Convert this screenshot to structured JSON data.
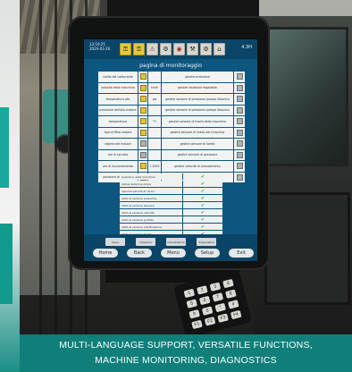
{
  "caption": {
    "line1": "MULTI-LANGUAGE SUPPORT, VERSATILE FUNCTIONS,",
    "line2": "MACHINE MONITORING, DIAGNOSTICS"
  },
  "screen": {
    "time": "13:19:25",
    "date": "2024-03-26",
    "version": "4.3H",
    "title": "pagina di monitoraggio",
    "toolbar_icons": [
      "yellow-key-icon",
      "yellow-key-icon",
      "warning-icon",
      "tool-icon",
      "alarm-icon",
      "tool-icon",
      "tool-icon",
      "home-icon"
    ],
    "rows": [
      {
        "label": "livello del carburante",
        "unit": "",
        "value": "",
        "desc": "gestire pressione",
        "icon": "box-icon"
      },
      {
        "label": "velocità della macchina",
        "unit": "",
        "value": "km/h",
        "desc": "gestire rotazione regolabile",
        "icon": "box-icon"
      },
      {
        "label": "temperatura olio",
        "unit": "",
        "value": "psi",
        "desc": "gestire sensore di pressione pompa idraulica",
        "icon": "box-icon"
      },
      {
        "label": "pressione dell'olio motore",
        "unit": "",
        "value": "",
        "desc": "gestire sensore di pressione pompa idraulica",
        "icon": "box-icon"
      },
      {
        "label": "temperatura",
        "unit": "",
        "value": "°C",
        "desc": "gestire sensore di livello della macchina",
        "icon": "box-icon"
      },
      {
        "label": "tipo di filtro motore",
        "unit": "",
        "value": "",
        "desc": "gestire sensore di livello del rimorchio",
        "icon": "box-icon"
      },
      {
        "label": "regime del motore",
        "unit": "",
        "value": "",
        "desc": "gestire sensore di livello",
        "icon": "box-icon"
      },
      {
        "label": "ore di servizio",
        "unit": "",
        "value": "",
        "desc": "gestire sensore di pressione",
        "icon": "box-icon"
      },
      {
        "label": "ore di funzionamento",
        "unit": "",
        "value": "1.2003",
        "desc": "gestire velocità di avanzamento",
        "icon": "box-icon"
      },
      {
        "label": "posizione del braccio",
        "unit": "",
        "value": "",
        "desc": "gestire velocità di sollevamento",
        "icon": "box-icon"
      }
    ],
    "lower_rows": [
      {
        "label": "posizione della macchina",
        "value": "ok"
      },
      {
        "label": "status della macchina",
        "value": "ok"
      },
      {
        "label": "sensore valvola di carico",
        "value": "ok"
      },
      {
        "label": "stato al sensore pressione",
        "value": "ok"
      },
      {
        "label": "stato al sensore sensore",
        "value": "ok"
      },
      {
        "label": "stato al sensore velocità",
        "value": "ok"
      },
      {
        "label": "stato al sensore portata",
        "value": "ok"
      },
      {
        "label": "stato al sensore lubrificazione",
        "value": "ok"
      },
      {
        "label": "stato al sensore livello",
        "value": "ok"
      }
    ],
    "softkeys": [
      "menu",
      "rotazione",
      "impostazioni",
      "diagnostica"
    ],
    "nav": [
      "Home",
      "Back",
      "Menu",
      "Setup",
      "Exit"
    ]
  },
  "keypad_keys": [
    "1",
    "2",
    "3",
    "4",
    "5",
    "6",
    "7",
    "8",
    "9",
    "0",
    "*",
    "#",
    "F1",
    "F2",
    "F3",
    "F4"
  ]
}
